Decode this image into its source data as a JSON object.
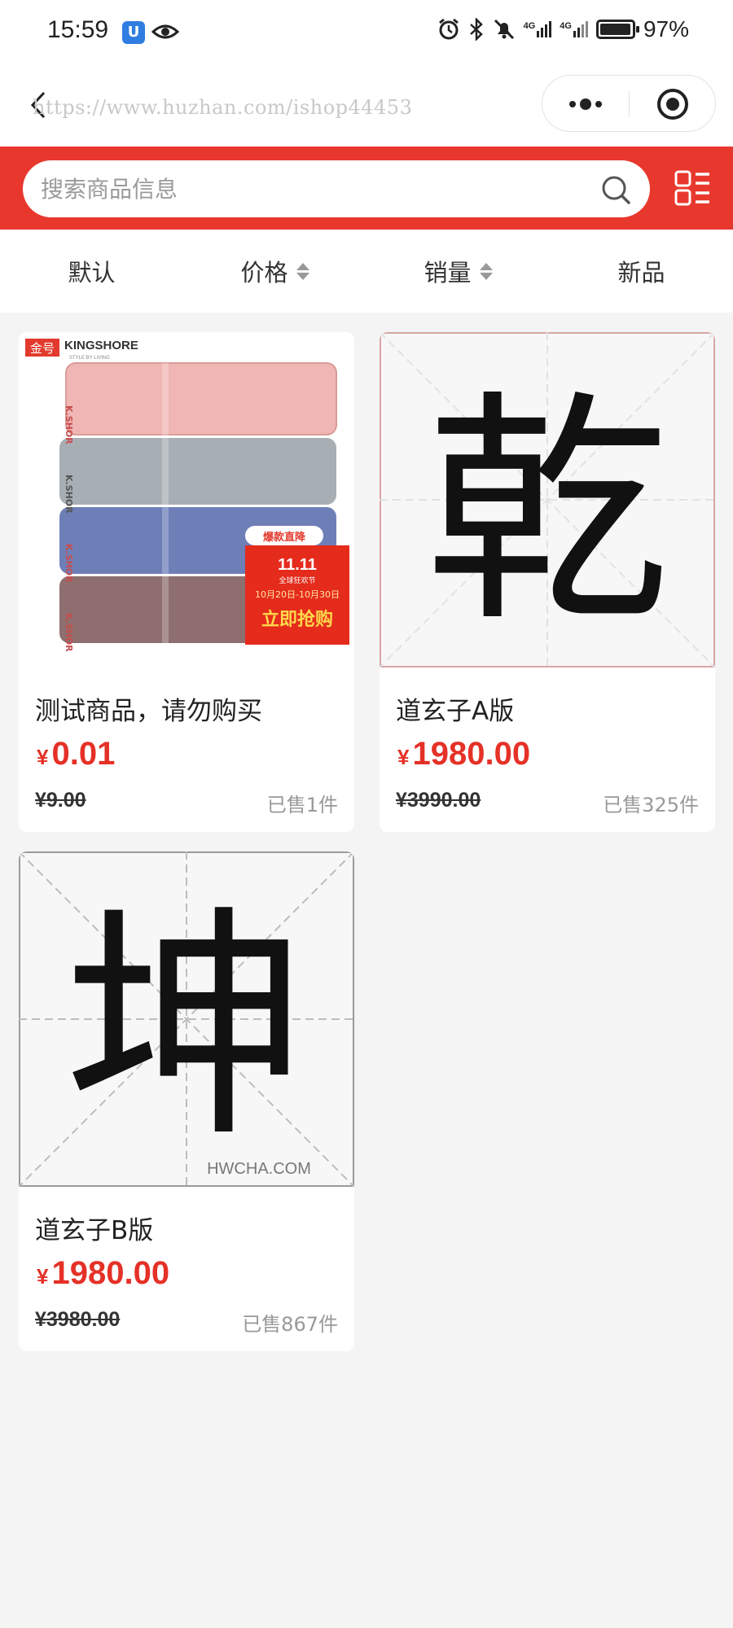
{
  "status_bar": {
    "time": "15:59",
    "battery": "97%",
    "battery_level": 0.97,
    "network_a": "4G",
    "network_b": "4G"
  },
  "nav": {
    "watermark": "https://www.huzhan.com/ishop44453"
  },
  "search": {
    "placeholder": "搜索商品信息",
    "value": ""
  },
  "sort_tabs": [
    {
      "label": "默认"
    },
    {
      "label": "价格"
    },
    {
      "label": "销量"
    },
    {
      "label": "新品"
    }
  ],
  "products": [
    {
      "title": "测试商品，请勿购买",
      "currency": "¥",
      "price": "0.01",
      "original_price": "¥9.00",
      "sold": "已售1件",
      "image": {
        "brand_badge": "金号",
        "brand": "KINGSHORE",
        "tagline": "STYLE BY LIVING",
        "side_text": "K.SHOR",
        "promo_tag": "爆款直降",
        "promo_title": "11.11",
        "promo_subtitle": "全球狂欢节",
        "promo_dates": "10月20日-10月30日",
        "promo_cta": "立即抢购"
      }
    },
    {
      "title": "道玄子A版",
      "currency": "¥",
      "price": "1980.00",
      "original_price": "¥3990.00",
      "sold": "已售325件",
      "image": {
        "glyph": "乾"
      }
    },
    {
      "title": "道玄子B版",
      "currency": "¥",
      "price": "1980.00",
      "original_price": "¥3980.00",
      "sold": "已售867件",
      "image": {
        "glyph": "坤",
        "watermark": "HWCHA.COM"
      }
    }
  ],
  "colors": {
    "brand_red": "#e8382e",
    "price_red": "#e53127",
    "page_bg": "#f4f4f5"
  }
}
